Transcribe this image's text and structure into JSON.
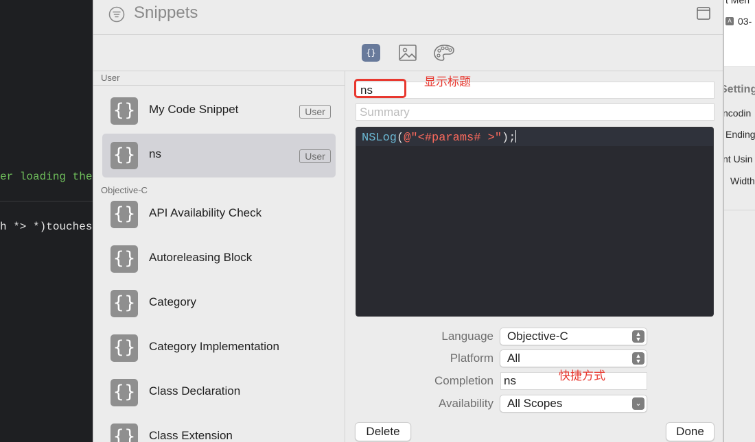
{
  "background_editor": {
    "line1": "er loading the",
    "line2": "h *> *)touches"
  },
  "background_inspector": {
    "top_text": "t Men",
    "date": "03-",
    "section": "Setting",
    "rows": [
      "ncodin",
      "Ending",
      "nt Usin",
      "Width"
    ]
  },
  "window": {
    "title": "Snippets"
  },
  "type_tabs": {
    "code_glyph": "{}"
  },
  "sidebar": {
    "sections": [
      {
        "header": "User",
        "items": [
          {
            "name": "My Code Snippet",
            "badge": "User"
          },
          {
            "name": "ns",
            "badge": "User"
          }
        ]
      },
      {
        "header": "Objective-C",
        "items": [
          {
            "name": "API Availability Check"
          },
          {
            "name": "Autoreleasing Block"
          },
          {
            "name": "Category"
          },
          {
            "name": "Category Implementation"
          },
          {
            "name": "Class Declaration"
          },
          {
            "name": "Class Extension"
          }
        ]
      }
    ],
    "icon_glyph": "{}"
  },
  "editor": {
    "title_value": "ns",
    "title_annotation": "显示标题",
    "summary_placeholder": "Summary",
    "code": {
      "fn": "NSLog",
      "open": "(",
      "str": "@\"<#params# >\"",
      "close": ");"
    }
  },
  "form": {
    "language_label": "Language",
    "language_value": "Objective-C",
    "platform_label": "Platform",
    "platform_value": "All",
    "completion_label": "Completion",
    "completion_value": "ns",
    "completion_annotation": "快捷方式",
    "availability_label": "Availability",
    "availability_value": "All Scopes"
  },
  "buttons": {
    "delete": "Delete",
    "done": "Done"
  },
  "colors": {
    "accent_tab": "#687a9b",
    "annotation_red": "#e8382f",
    "code_background": "#292a30",
    "selection": "#d3d3d8"
  }
}
